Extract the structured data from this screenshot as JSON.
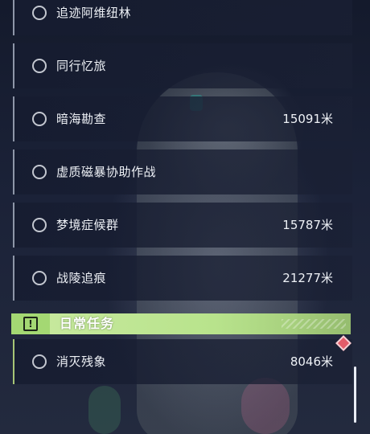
{
  "tasks": [
    {
      "name": "追迹阿维纽林",
      "distance": ""
    },
    {
      "name": "同行忆旅",
      "distance": ""
    },
    {
      "name": "暗海勘查",
      "distance": "15091米"
    },
    {
      "name": "虚质磁暴协助作战",
      "distance": ""
    },
    {
      "name": "梦境症候群",
      "distance": "15787米"
    },
    {
      "name": "战陵追痕",
      "distance": "21277米"
    }
  ],
  "daily_section": {
    "title": "日常任务",
    "badge_icon": "exclamation-icon",
    "tasks": [
      {
        "name": "消灭残象",
        "distance": "8046米"
      }
    ]
  },
  "colors": {
    "accent_green": "#b8e38c",
    "row_bg": "#1a2034",
    "alert_red": "#e35c6a"
  }
}
